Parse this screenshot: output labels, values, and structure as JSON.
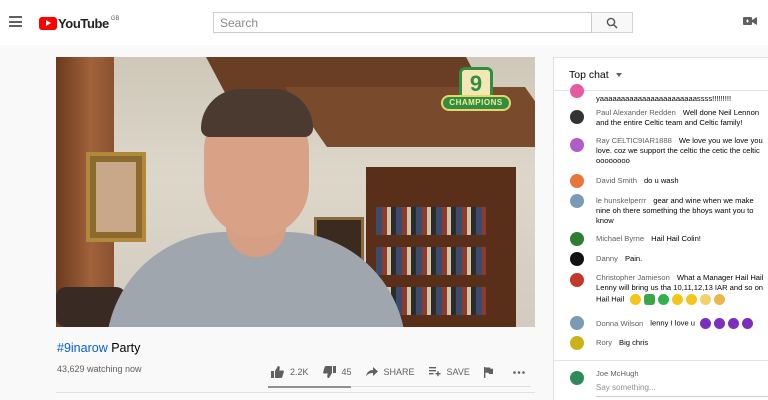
{
  "header": {
    "logo_text": "YouTube",
    "logo_region": "GB",
    "search_placeholder": "Search"
  },
  "video": {
    "overlay_badge_number": "9",
    "overlay_badge_text": "CHAMPIONS"
  },
  "info": {
    "title_tag": "#9inarow",
    "title_rest": " Party",
    "watching": "43,629 watching now",
    "like_count": "2.2K",
    "dislike_count": "45",
    "share_label": "SHARE",
    "save_label": "SAVE"
  },
  "chat": {
    "header_label": "Top chat",
    "messages": [
      {
        "author": "",
        "text": "yaaaaaaaaaaaaaaaaaaaaaaassss!!!!!!!!!",
        "avatar_color": "#e65aa0"
      },
      {
        "author": "Paul Alexander Redden",
        "text": "Well done Neil Lennon",
        "text2": "and the entire Celtic team and Celtic family!",
        "avatar_color": "#333333"
      },
      {
        "author": "Ray CELTIC9IAR1888",
        "text": "We love you we love you",
        "text2": "love. coz we support the celtic the cetic the celtic",
        "text3": "oooooooo",
        "avatar_color": "#b05cc9"
      },
      {
        "author": "David Smith",
        "text": "do u wash",
        "avatar_color": "#e8763a"
      },
      {
        "author": "le hunskelperrr",
        "text": "gear and wine when we make",
        "text2": "nine oh there something the bhoys want you to",
        "text3": "know",
        "avatar_color": "#7a9bb5"
      },
      {
        "author": "Michael Byrne",
        "text": "Hail Hail Colin!",
        "avatar_color": "#2e7d32"
      },
      {
        "author": "Danny",
        "text": "Pain.",
        "avatar_color": "#111111"
      },
      {
        "author": "Christopher Jamieson",
        "text": "What a Manager Hail Hail",
        "text2": "Lenny will bring us tha 10,11,12,13 IAR and so on",
        "text3": "Hail Hail",
        "avatar_color": "#c0392b"
      },
      {
        "author": "Donna Wilson",
        "text": "lenny I love u",
        "avatar_color": "#7a9bb5"
      },
      {
        "author": "Rory",
        "text": "Big chris",
        "avatar_color": "#c9b21a"
      }
    ],
    "input": {
      "name": "Joe McHugh",
      "placeholder": "Say something..."
    }
  }
}
